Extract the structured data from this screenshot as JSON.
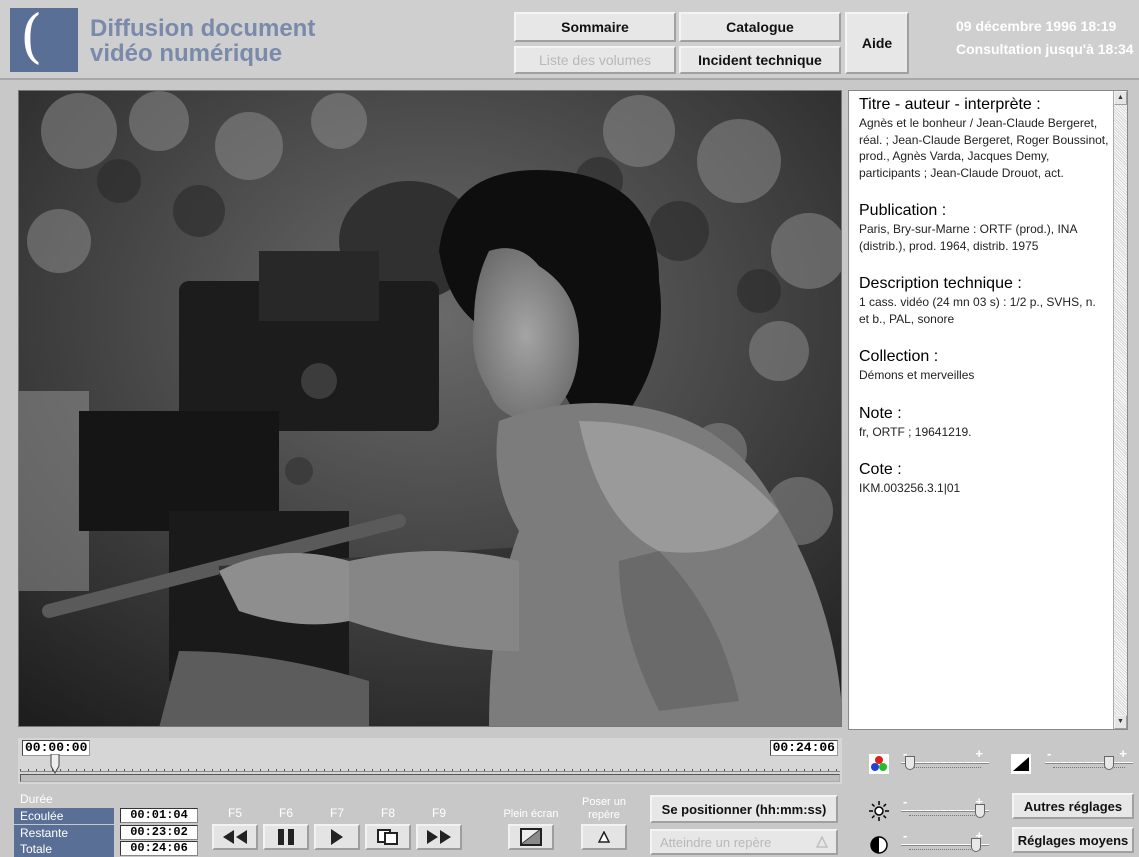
{
  "header": {
    "title_line1": "Diffusion document",
    "title_line2": "vidéo numérique",
    "nav": {
      "sommaire": "Sommaire",
      "catalogue": "Catalogue",
      "liste_volumes": "Liste des volumes",
      "incident": "Incident technique",
      "aide": "Aide"
    },
    "date": "09 décembre 1996 18:19",
    "consultation": "Consultation jusqu'à 18:34"
  },
  "info": {
    "sections": [
      {
        "head": "Titre - auteur - interprète :",
        "text": "Agnès et le bonheur / Jean-Claude Bergeret, réal. ; Jean-Claude Bergeret, Roger Boussinot, prod., Agnès Varda, Jacques Demy, participants ; Jean-Claude Drouot, act."
      },
      {
        "head": "Publication :",
        "text": "Paris, Bry-sur-Marne : ORTF (prod.), INA (distrib.), prod. 1964, distrib. 1975"
      },
      {
        "head": "Description technique :",
        "text": "1 cass. vidéo (24 mn 03 s) : 1/2 p., SVHS, n. et b., PAL, sonore"
      },
      {
        "head": "Collection :",
        "text": "Démons et merveilles"
      },
      {
        "head": "Note :",
        "text": "fr, ORTF ; 19641219."
      },
      {
        "head": "Cote :",
        "text": "IKM.003256.3.1|01"
      }
    ]
  },
  "timeline": {
    "start": "00:00:00",
    "end": "00:24:06",
    "position_fraction": 0.043
  },
  "stats": {
    "duree": "Durée",
    "ecoulee_label": "Ecoulée",
    "ecoulee": "00:01:04",
    "restante_label": "Restante",
    "restante": "00:23:02",
    "totale_label": "Totale",
    "totale": "00:24:06"
  },
  "controls": {
    "f5": "F5",
    "f6": "F6",
    "f7": "F7",
    "f8": "F8",
    "f9": "F9",
    "plein_ecran": "Plein écran",
    "poser_repere_1": "Poser un",
    "poser_repere_2": "repère",
    "positionner": "Se positionner (hh:mm:ss)",
    "atteindre": "Atteindre un repère"
  },
  "settings": {
    "autres": "Autres réglages",
    "moyens": "Réglages moyens",
    "minus": "-",
    "plus": "+",
    "color_level": 0.05,
    "sharpness_level": 0.75,
    "brightness_level": 0.95,
    "contrast_level": 0.9
  }
}
